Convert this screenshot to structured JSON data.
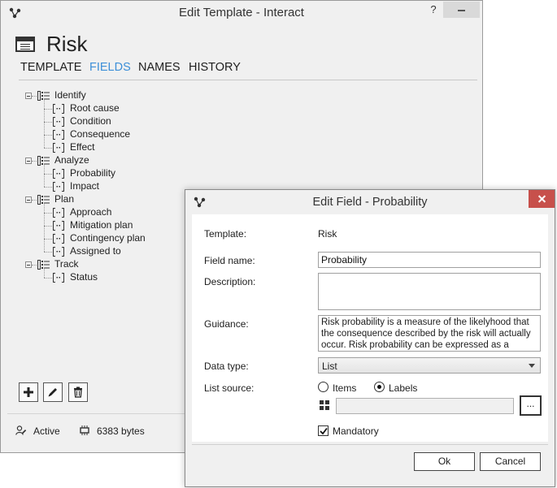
{
  "main_window": {
    "title": "Edit Template - Interact",
    "help_label": "?",
    "header_title": "Risk",
    "tabs": [
      "TEMPLATE",
      "FIELDS",
      "NAMES",
      "HISTORY"
    ],
    "active_tab": "FIELDS",
    "tree": [
      {
        "label": "Identify",
        "children": [
          "Root cause",
          "Condition",
          "Consequence",
          "Effect"
        ]
      },
      {
        "label": "Analyze",
        "children": [
          "Probability",
          "Impact"
        ]
      },
      {
        "label": "Plan",
        "children": [
          "Approach",
          "Mitigation plan",
          "Contingency plan",
          "Assigned to"
        ]
      },
      {
        "label": "Track",
        "children": [
          "Status"
        ]
      }
    ],
    "toolbar": {
      "add_icon": "plus-icon",
      "edit_icon": "pencil-icon",
      "delete_icon": "trash-icon"
    },
    "status": {
      "state": "Active",
      "size": "6383 bytes"
    }
  },
  "dialog": {
    "title": "Edit Field - Probability",
    "template_label": "Template:",
    "template_value": "Risk",
    "field_name_label": "Field name:",
    "field_name_value": "Probability",
    "description_label": "Description:",
    "description_value": "",
    "guidance_label": "Guidance:",
    "guidance_value": "Risk probability is a measure of the likelyhood that the consequence described by the risk will actually occur. Risk probability can be expressed as a simple mapping of",
    "data_type_label": "Data type:",
    "data_type_value": "List",
    "list_source_label": "List source:",
    "list_source_options": [
      "Items",
      "Labels"
    ],
    "list_source_selected": "Labels",
    "browse_label": "...",
    "mandatory_label": "Mandatory",
    "mandatory_checked": true,
    "ok_label": "Ok",
    "cancel_label": "Cancel"
  },
  "colors": {
    "accent": "#3c8fd8",
    "close_button": "#c7504b"
  }
}
